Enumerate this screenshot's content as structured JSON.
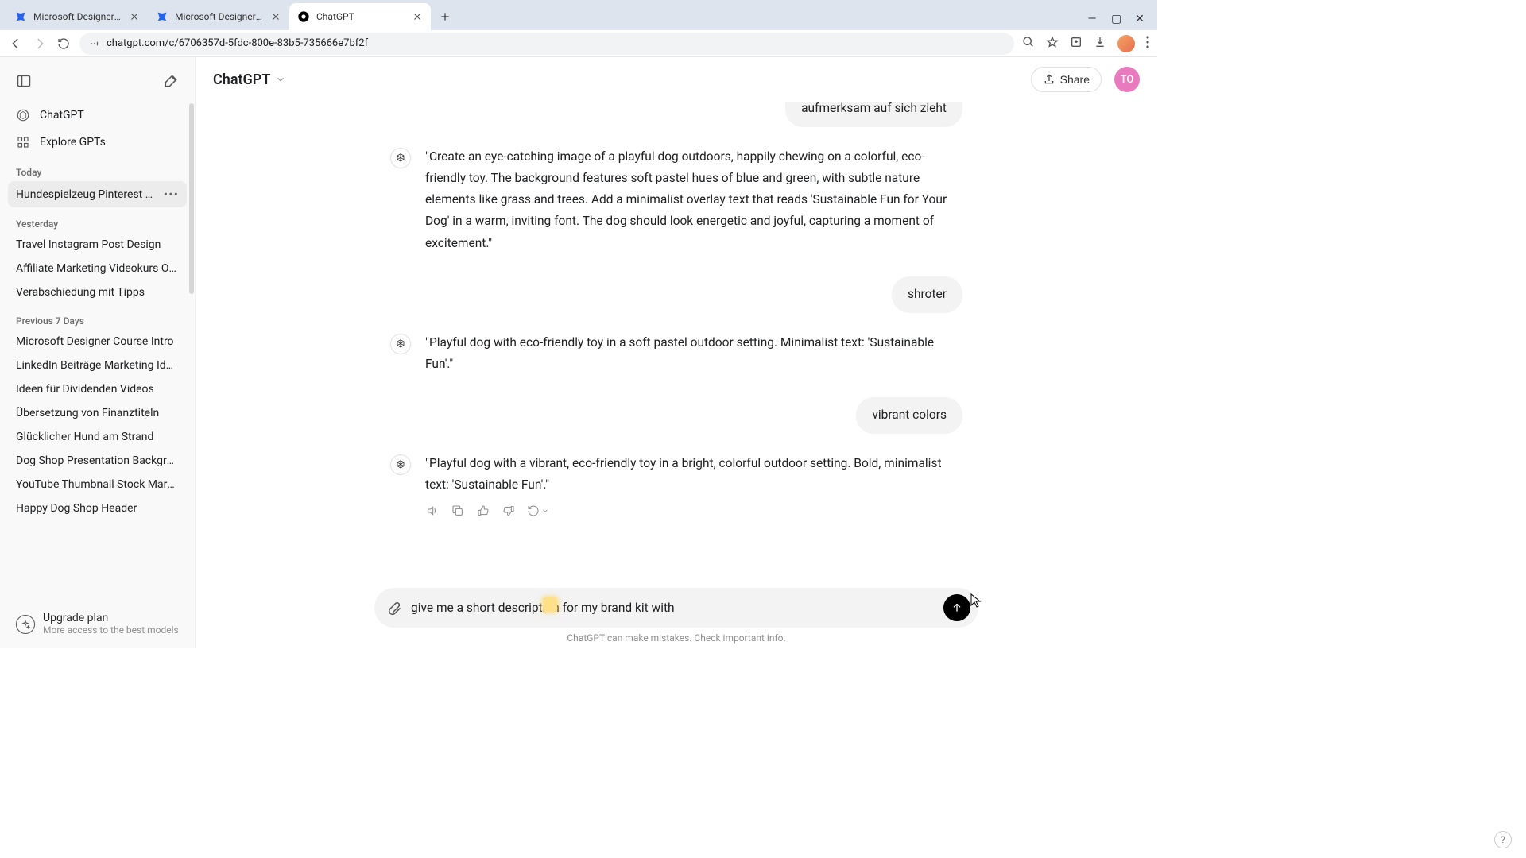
{
  "browser": {
    "tabs": [
      {
        "title": "Microsoft Designer - Stunning",
        "favicon": "ms"
      },
      {
        "title": "Microsoft Designer - Stunning",
        "favicon": "ms"
      },
      {
        "title": "ChatGPT",
        "favicon": "gpt",
        "active": true
      }
    ],
    "url": "chatgpt.com/c/6706357d-5fdc-800e-83b5-735666e7bf2f"
  },
  "header": {
    "model": "ChatGPT",
    "share_label": "Share",
    "avatar_initials": "TO"
  },
  "sidebar": {
    "nav": {
      "chatgpt": "ChatGPT",
      "explore": "Explore GPTs"
    },
    "sections": {
      "today": "Today",
      "yesterday": "Yesterday",
      "prev7": "Previous 7 Days"
    },
    "today_items": [
      "Hundespielzeug Pinterest Header"
    ],
    "yesterday_items": [
      "Travel Instagram Post Design",
      "Affiliate Marketing Videokurs Outline",
      "Verabschiedung mit Tipps"
    ],
    "prev7_items": [
      "Microsoft Designer Course Intro",
      "LinkedIn Beiträge Marketing Ideen",
      "Ideen für Dividenden Videos",
      "Übersetzung von Finanztiteln",
      "Glücklicher Hund am Strand",
      "Dog Shop Presentation Background",
      "YouTube Thumbnail Stock Market",
      "Happy Dog Shop Header"
    ],
    "upgrade": {
      "title": "Upgrade plan",
      "subtitle": "More access to the best models"
    }
  },
  "chat": {
    "msg_user_cut": "aufmerksam auf sich zieht",
    "msg_ai_1": "\"Create an eye-catching image of a playful dog outdoors, happily chewing on a colorful, eco-friendly toy. The background features soft pastel hues of blue and green, with subtle nature elements like grass and trees. Add a minimalist overlay text that reads 'Sustainable Fun for Your Dog' in a warm, inviting font. The dog should look energetic and joyful, capturing a moment of excitement.\"",
    "msg_user_2": "shroter",
    "msg_ai_2": "\"Playful dog with eco-friendly toy in a soft pastel outdoor setting. Minimalist text: 'Sustainable Fun'.\"",
    "msg_user_3": "vibrant colors",
    "msg_ai_3": "\"Playful dog with a vibrant, eco-friendly toy in a bright, colorful outdoor setting. Bold, minimalist text: 'Sustainable Fun'.\""
  },
  "composer": {
    "value": "give me a short description for my brand kit with"
  },
  "disclaimer": "ChatGPT can make mistakes. Check important info."
}
